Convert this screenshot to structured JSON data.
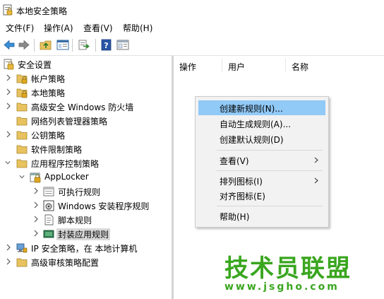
{
  "window": {
    "title": "本地安全策略"
  },
  "menu": [
    "文件(F)",
    "操作(A)",
    "查看(V)",
    "帮助(H)"
  ],
  "toolbar": {
    "icons": [
      "back-arrow-icon",
      "forward-arrow-icon",
      "up-folder-icon",
      "show-hide-tree-icon",
      "export-list-icon",
      "help-icon",
      "properties-icon"
    ]
  },
  "tree": [
    {
      "label": "安全设置",
      "icon": "security-settings-icon",
      "level": 0,
      "expander": "none"
    },
    {
      "label": "帐户策略",
      "icon": "folder-lock-icon",
      "level": 1,
      "expander": "collapsed"
    },
    {
      "label": "本地策略",
      "icon": "folder-lock-icon",
      "level": 1,
      "expander": "collapsed"
    },
    {
      "label": "高级安全 Windows 防火墙",
      "icon": "folder-icon",
      "level": 1,
      "expander": "collapsed"
    },
    {
      "label": "网络列表管理器策略",
      "icon": "folder-icon",
      "level": 1,
      "expander": "none"
    },
    {
      "label": "公钥策略",
      "icon": "folder-icon",
      "level": 1,
      "expander": "collapsed"
    },
    {
      "label": "软件限制策略",
      "icon": "folder-icon",
      "level": 1,
      "expander": "none"
    },
    {
      "label": "应用程序控制策略",
      "icon": "folder-icon",
      "level": 1,
      "expander": "expanded"
    },
    {
      "label": "AppLocker",
      "icon": "applocker-icon",
      "level": 2,
      "expander": "expanded"
    },
    {
      "label": "可执行规则",
      "icon": "executable-rules-icon",
      "level": 3,
      "expander": "collapsed"
    },
    {
      "label": "Windows 安装程序规则",
      "icon": "installer-rules-icon",
      "level": 3,
      "expander": "collapsed"
    },
    {
      "label": "脚本规则",
      "icon": "script-rules-icon",
      "level": 3,
      "expander": "collapsed"
    },
    {
      "label": "封装应用规则",
      "icon": "packaged-app-rules-icon",
      "level": 3,
      "expander": "collapsed",
      "selected": true
    },
    {
      "label": "IP 安全策略，在 本地计算机",
      "icon": "ip-security-icon",
      "level": 1,
      "expander": "collapsed"
    },
    {
      "label": "高级审核策略配置",
      "icon": "folder-icon",
      "level": 1,
      "expander": "collapsed"
    }
  ],
  "columns": [
    "操作",
    "用户",
    "名称"
  ],
  "context_menu": [
    {
      "label": "创建新规则(N)...",
      "highlight": true
    },
    {
      "label": "自动生成规则(A)..."
    },
    {
      "label": "创建默认规则(D)"
    },
    {
      "separator": true
    },
    {
      "label": "查看(V)",
      "submenu": true
    },
    {
      "separator": true
    },
    {
      "label": "排列图标(I)",
      "submenu": true
    },
    {
      "label": "对齐图标(E)"
    },
    {
      "separator": true
    },
    {
      "label": "帮助(H)"
    }
  ],
  "watermark": {
    "title": "技术员联盟",
    "url": "www.jsgho.com",
    "color": "#3aa61f"
  },
  "colors": {
    "highlight": "#91c9f7",
    "selected_tree": "#d9d9d9",
    "folder": "#e8c25e"
  }
}
